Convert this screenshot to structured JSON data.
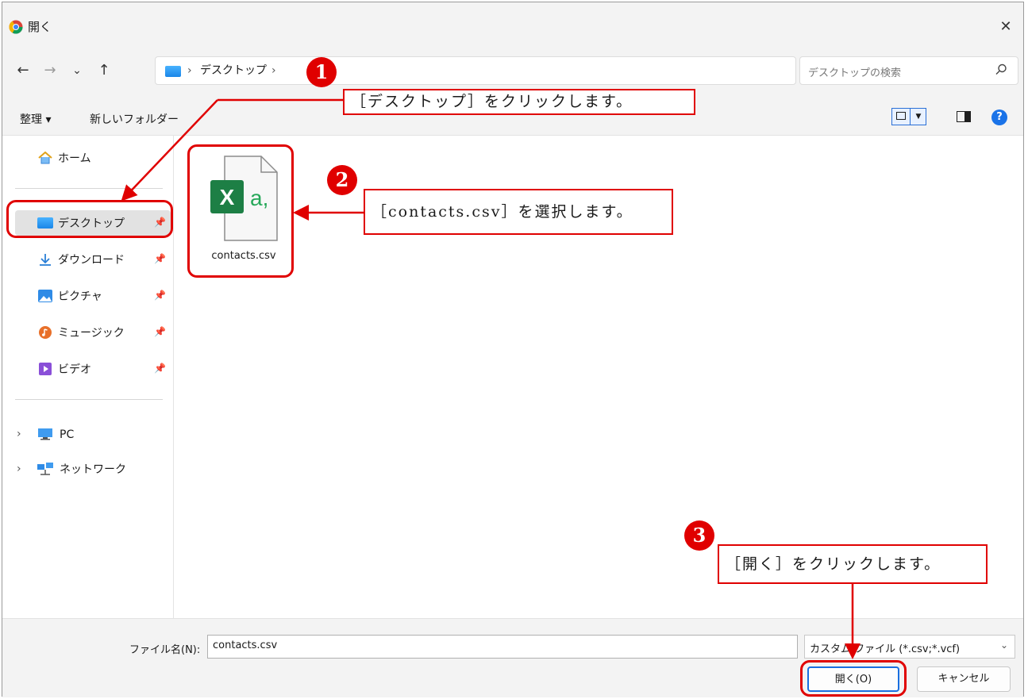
{
  "window": {
    "title": "開く",
    "close_glyph": "✕"
  },
  "nav": {
    "back_glyph": "←",
    "forward_glyph": "→",
    "recent_glyph": "⌄",
    "up_glyph": "↑",
    "sep_glyph": "›",
    "breadcrumb": "デスクトップ",
    "search_placeholder": "デスクトップの検索"
  },
  "toolbar": {
    "organize": "整理 ▾",
    "new_folder": "新しいフォルダー",
    "help": "?"
  },
  "sidebar": {
    "pin_glyph": "📌",
    "expand_glyph": "›",
    "items": [
      {
        "label": "ホーム",
        "icon": "home-icon"
      },
      {
        "label": "デスクトップ",
        "icon": "desktop-folder-icon",
        "selected": true
      },
      {
        "label": "ダウンロード",
        "icon": "download-icon"
      },
      {
        "label": "ピクチャ",
        "icon": "pictures-icon"
      },
      {
        "label": "ミュージック",
        "icon": "music-icon"
      },
      {
        "label": "ビデオ",
        "icon": "video-icon"
      },
      {
        "label": "PC",
        "icon": "pc-icon"
      },
      {
        "label": "ネットワーク",
        "icon": "network-icon"
      }
    ]
  },
  "files": [
    {
      "name": "contacts.csv",
      "icon": "excel-csv-icon"
    }
  ],
  "bottom": {
    "filename_label": "ファイル名(N):",
    "filename_value": "contacts.csv",
    "filter_value": "カスタム ファイル (*.csv;*.vcf)",
    "open_label": "開く(O)",
    "cancel_label": "キャンセル"
  },
  "annotations": [
    {
      "number": "1",
      "text": "［デスクトップ］をクリックします。"
    },
    {
      "number": "2",
      "text": "［contacts.csv］を選択します。"
    },
    {
      "number": "3",
      "text": "［開く］をクリックします。"
    }
  ],
  "colors": {
    "annotation_red": "#e00000",
    "accent_blue": "#1a6fe0"
  }
}
